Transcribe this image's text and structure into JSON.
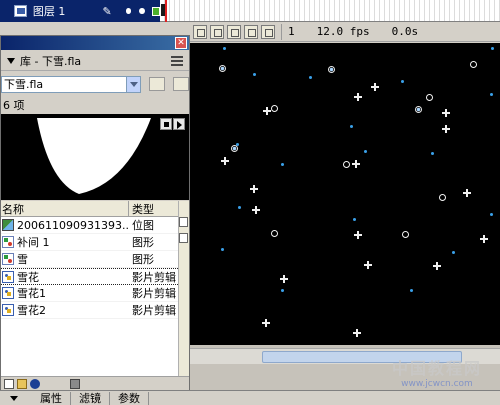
{
  "timeline": {
    "layer_name": "图层 1",
    "frame_number": "1",
    "fps": "12.0 fps",
    "elapsed": "0.0s"
  },
  "library": {
    "title": "库 - 下雪.fla",
    "document_select_value": "下雪.fla",
    "count_text": "6 项",
    "columns": {
      "name": "名称",
      "type": "类型"
    },
    "items": [
      {
        "name": "200611090931393...",
        "type": "位图",
        "icon": "bitmap-icon"
      },
      {
        "name": "补间 1",
        "type": "图形",
        "icon": "graphic-icon"
      },
      {
        "name": "雪",
        "type": "图形",
        "icon": "graphic-icon"
      },
      {
        "name": "雪花",
        "type": "影片剪辑",
        "icon": "movie-clip-icon",
        "selected": true
      },
      {
        "name": "雪花1",
        "type": "影片剪辑",
        "icon": "movie-clip-icon"
      },
      {
        "name": "雪花2",
        "type": "影片剪辑",
        "icon": "movie-clip-icon"
      }
    ]
  },
  "props_tabs": [
    "属性",
    "滤镜",
    "参数"
  ],
  "watermark": {
    "title": "中国教程网",
    "url": "www.jcwcn.com"
  },
  "colors": {
    "stage_bg": "#000000",
    "flake_blue": "#3aa0e8",
    "selection_blue": "#0a246a"
  }
}
